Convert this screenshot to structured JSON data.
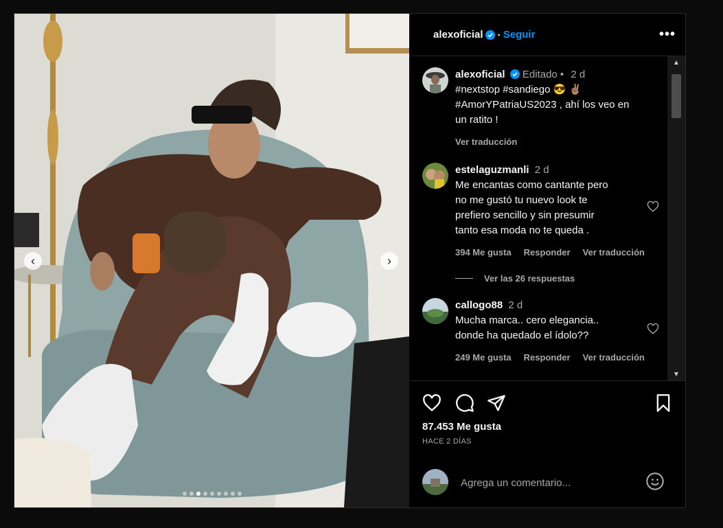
{
  "header": {
    "username": "alexoficial",
    "separator": "•",
    "follow_label": "Seguir",
    "more_label": "•••"
  },
  "caption": {
    "username": "alexoficial",
    "edited": "Editado •",
    "age": "2 d",
    "text_line1": "#nextstop #sandiego 😎 ✌🏽",
    "text_line2": "#AmorYPatriaUS2023 , ahí los veo en",
    "text_line3": "un ratito !",
    "translate": "Ver traducción"
  },
  "comments": [
    {
      "username": "estelaguzmanli",
      "age": "2 d",
      "lines": [
        "Me encantas como cantante pero",
        "no me gustó tu nuevo look te",
        "prefiero sencillo y sin presumir",
        "tanto esa moda no te queda ."
      ],
      "likes": "394 Me gusta",
      "reply": "Responder",
      "translate": "Ver traducción"
    },
    {
      "username": "callogo88",
      "age": "2 d",
      "lines": [
        "Mucha marca.. cero elegancia..",
        "donde ha quedado el ídolo??"
      ],
      "likes": "249 Me gusta",
      "reply": "Responder",
      "translate": "Ver traducción"
    }
  ],
  "view_replies": "Ver las 26 respuestas",
  "post": {
    "likes": "87.453 Me gusta",
    "time": "HACE 2 DÍAS"
  },
  "comment_input": {
    "placeholder": "Agrega un comentario..."
  },
  "carousel": {
    "prev_icon": "‹",
    "next_icon": "›",
    "slide_count": 9,
    "active_slide": 3
  },
  "colors": {
    "accent": "#0095f6",
    "verified": "#0095f6",
    "background": "#000000",
    "muted": "#a8a8a8"
  }
}
